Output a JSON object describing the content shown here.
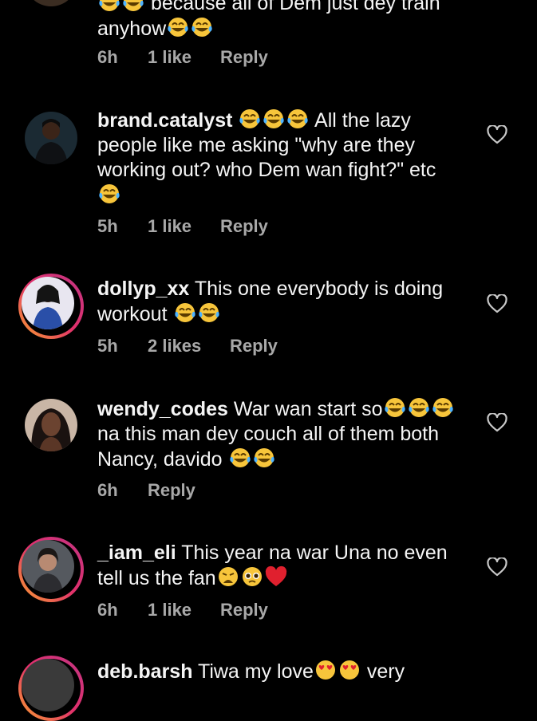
{
  "comments": [
    {
      "text_a": "because all of Dem just dey train",
      "text_b": "anyhow",
      "time": "6h",
      "likes": "1 like",
      "reply": "Reply"
    },
    {
      "username": "brand.catalyst",
      "text": "All the lazy people like me asking \"why are they working out? who Dem wan fight?\" etc",
      "time": "5h",
      "likes": "1 like",
      "reply": "Reply"
    },
    {
      "username": "dollyp_xx",
      "text": "This one everybody is doing workout",
      "time": "5h",
      "likes": "2 likes",
      "reply": "Reply"
    },
    {
      "username": "wendy_codes",
      "text_a": "War wan start so",
      "text_b": "na this man dey couch all of them both Nancy, davido",
      "time": "6h",
      "reply": "Reply"
    },
    {
      "username": "_iam_eli",
      "text_a": "This year na war Una no even tell us the fan",
      "time": "6h",
      "likes": "1 like",
      "reply": "Reply"
    },
    {
      "username": "deb.barsh",
      "text": "Tiwa my love",
      "text_b": "very"
    }
  ],
  "icons": {
    "like": "heart-outline-icon",
    "laugh": "face-with-tears-of-joy-icon",
    "weary": "weary-face-icon",
    "pleading": "pleading-face-icon",
    "love": "red-heart-icon",
    "heart_eyes": "heart-eyes-icon"
  },
  "colors": {
    "background": "#000000",
    "text": "#f5f5f5",
    "meta": "#a8a8a8",
    "story_ring": "#e1306c"
  }
}
